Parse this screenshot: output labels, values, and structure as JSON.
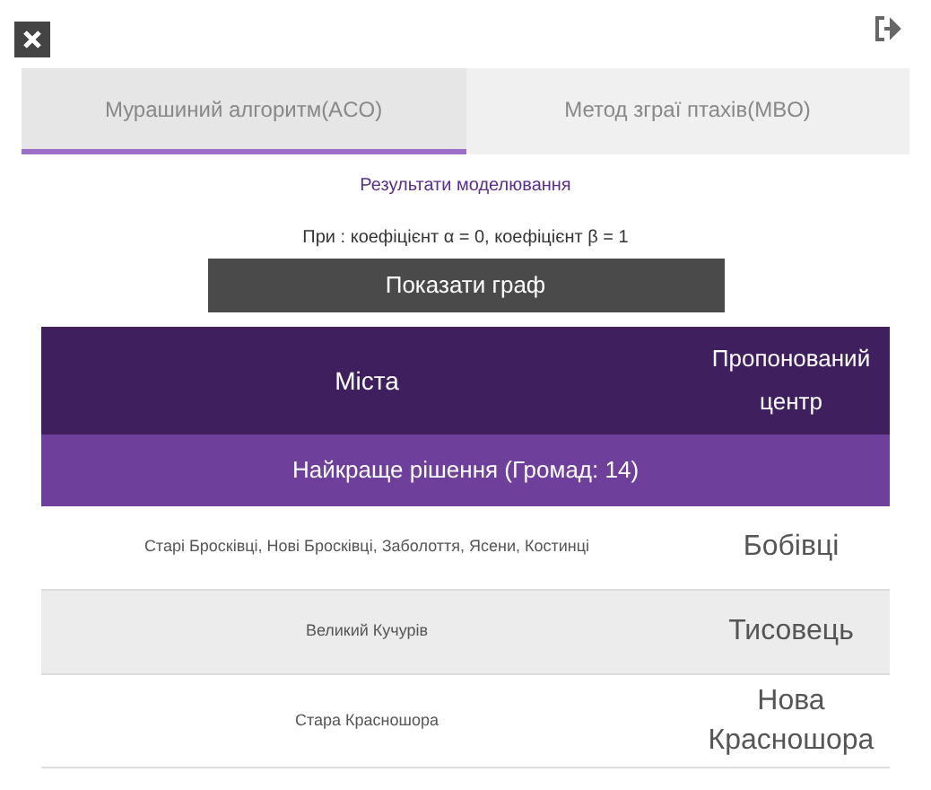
{
  "tabs": [
    {
      "label": "Мурашиний алгоритм(ACO)",
      "selected": true
    },
    {
      "label": "Метод зграї птахів(MBO)",
      "selected": false
    }
  ],
  "results_title": "Результати моделювання",
  "parameters": "При : коефіцієнт α = 0, коефіцієнт β = 1",
  "show_graph_button": "Показати граф",
  "table": {
    "columns": [
      "Міста",
      "Пропонований центр"
    ],
    "group_header": "Найкраще рішення (Громад: 14)",
    "rows": [
      {
        "cities": "Старі Бросківці, Нові Бросківці, Заболоття, Ясени, Костинці",
        "center": "Бобівці"
      },
      {
        "cities": "Великий Кучурів",
        "center": "Тисовець"
      },
      {
        "cities": "Стара Красношора",
        "center": "Нова Красношора"
      }
    ]
  }
}
